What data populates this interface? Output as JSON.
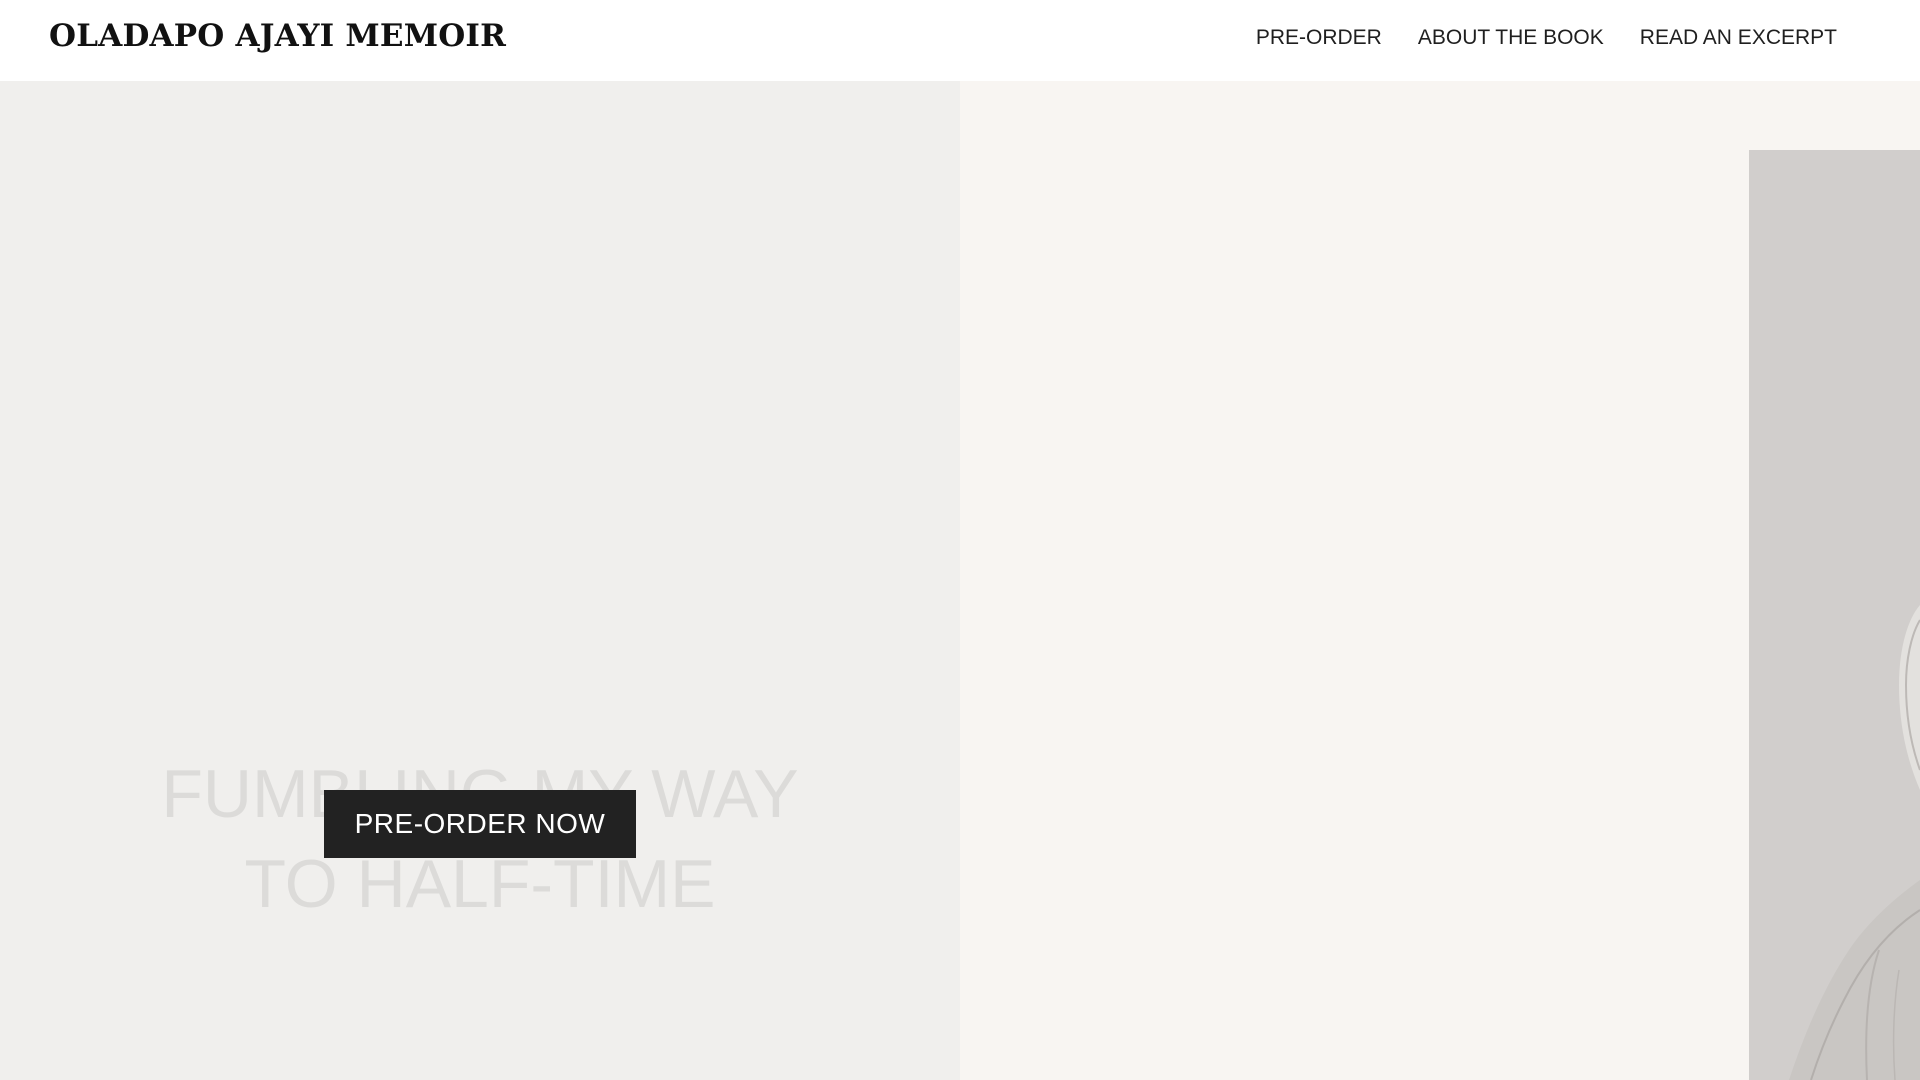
{
  "header": {
    "brand": "OLADAPO AJAYI MEMOIR",
    "nav": [
      {
        "label": "PRE-ORDER"
      },
      {
        "label": "ABOUT THE BOOK"
      },
      {
        "label": "READ AN EXCERPT"
      }
    ]
  },
  "hero": {
    "title_line1": "FUMBLING MY WAY",
    "title_line2": "TO HALF-TIME",
    "cta_label": "PRE-ORDER NOW"
  },
  "colors": {
    "left_panel_bg": "#f0efed",
    "right_panel_bg": "#f8f5f2",
    "photo_bg": "#d1cecc",
    "cta_bg": "#222222",
    "hero_text": "#dcdbd9"
  }
}
